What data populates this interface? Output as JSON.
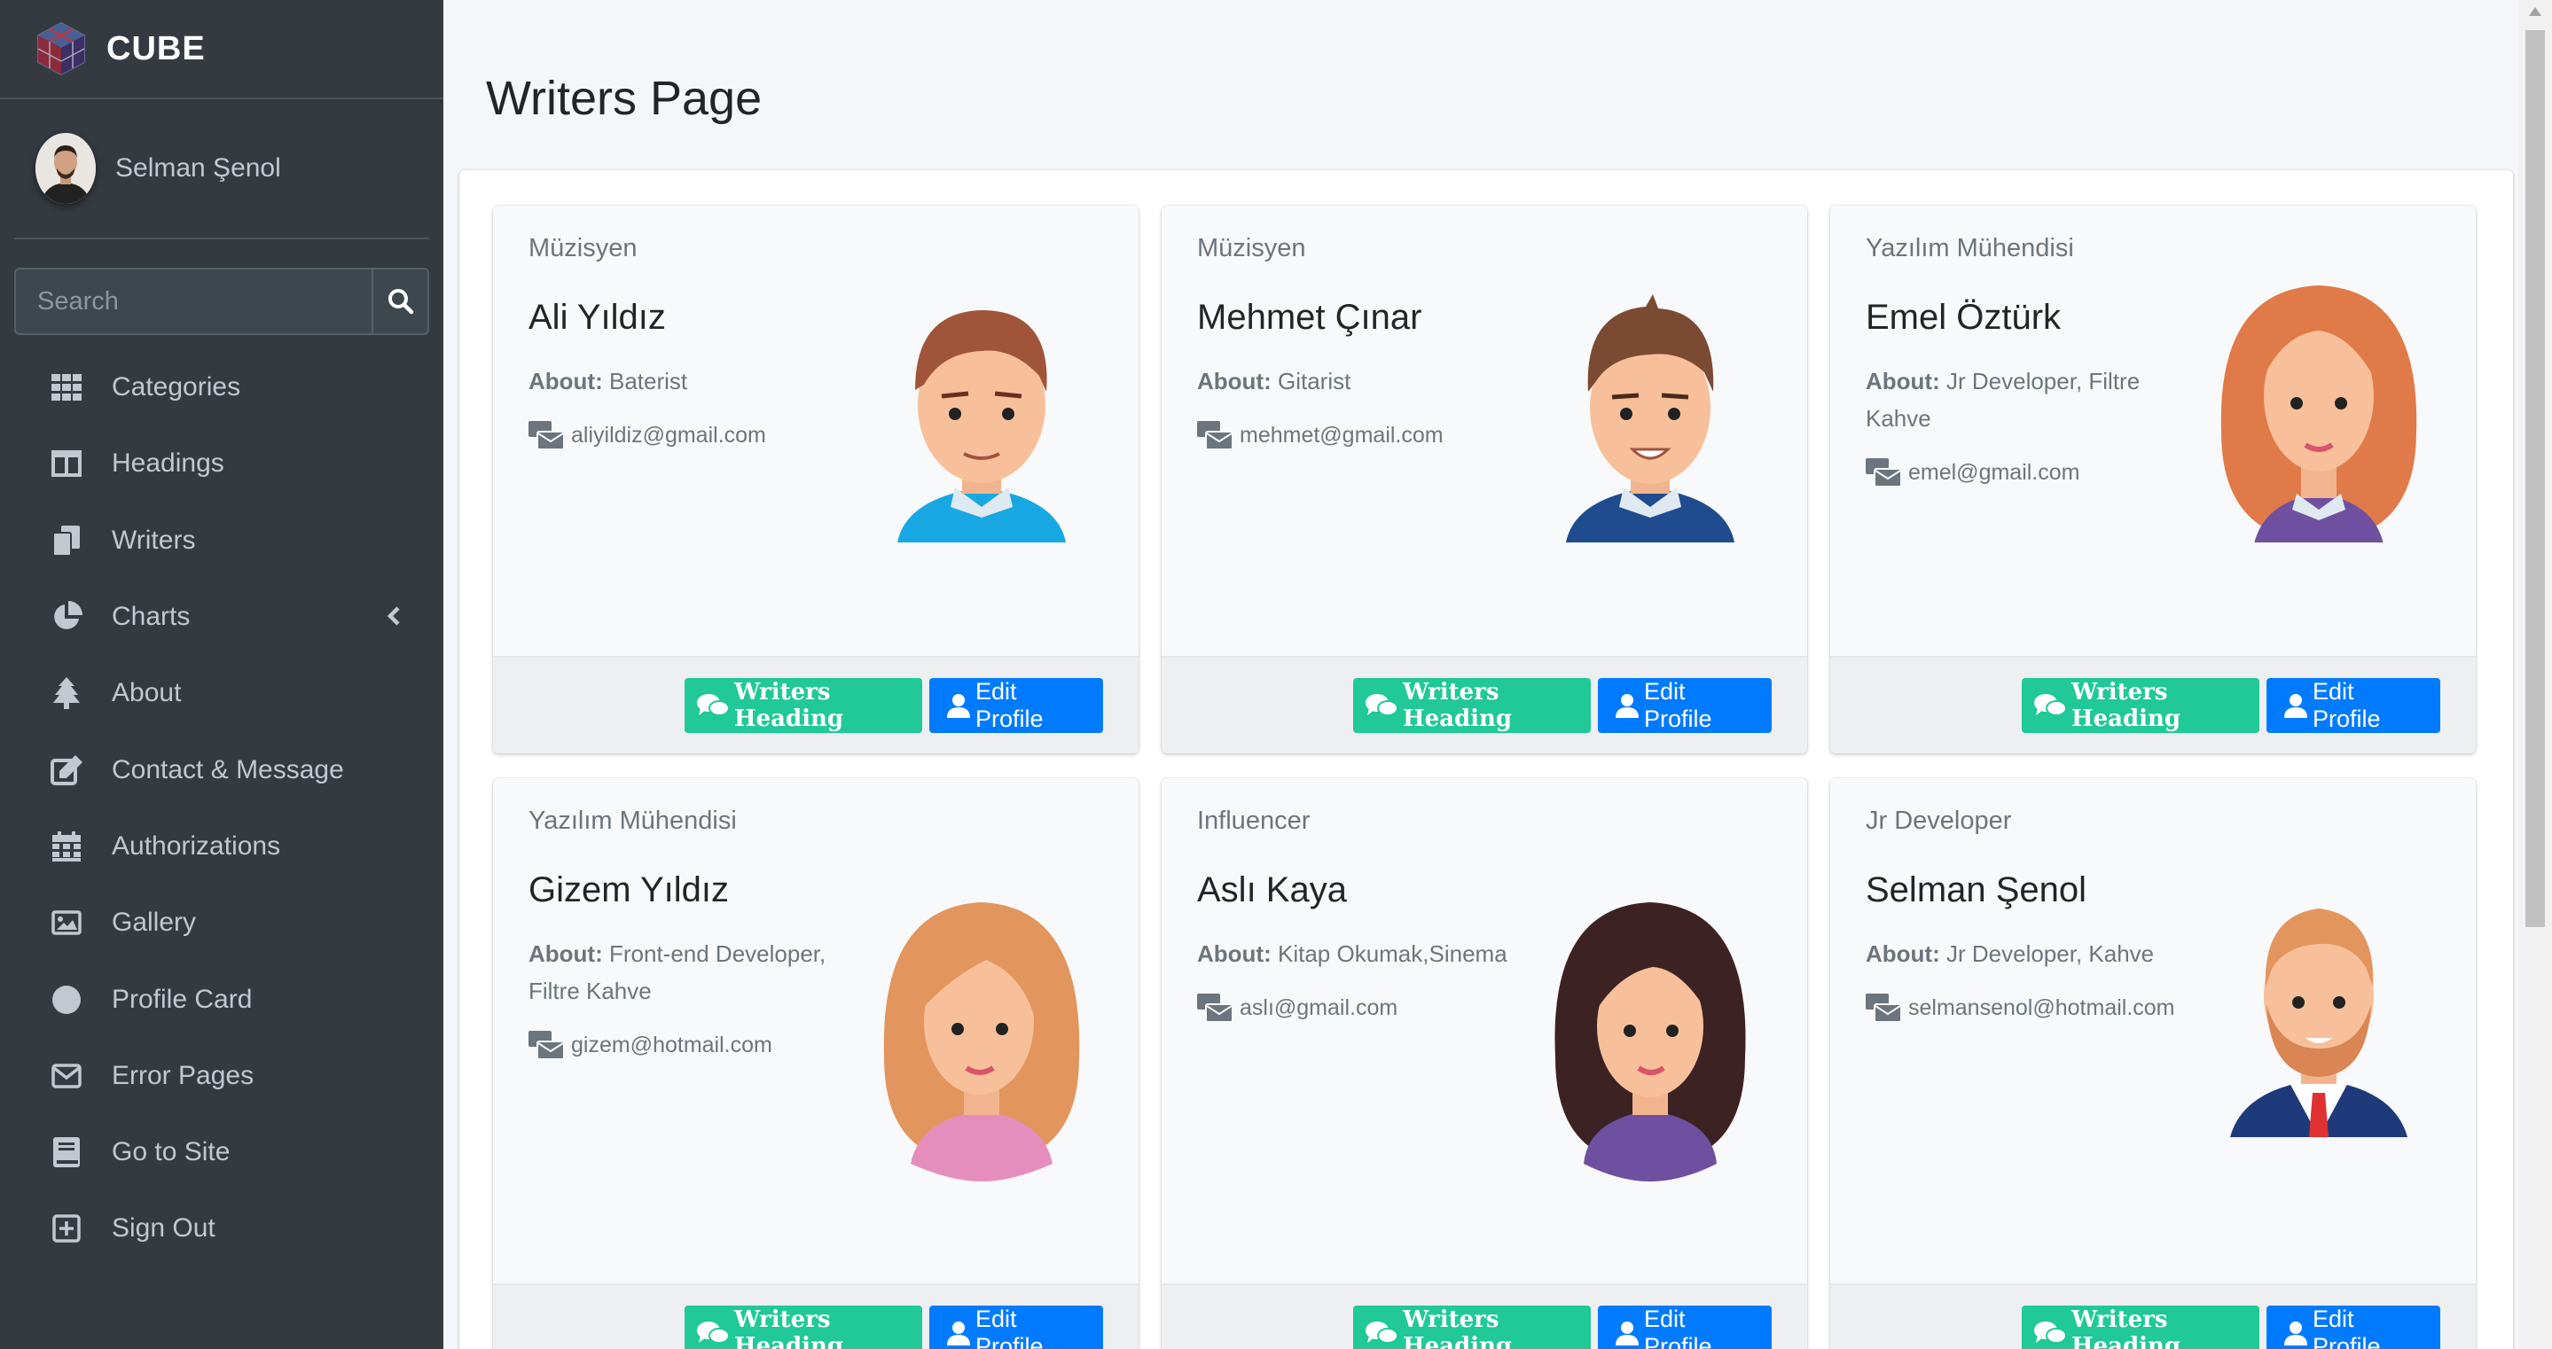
{
  "brand": {
    "name": "CUBE"
  },
  "user": {
    "name": "Selman Şenol"
  },
  "search": {
    "placeholder": "Search"
  },
  "nav": [
    {
      "label": "Categories",
      "icon": "th-icon"
    },
    {
      "label": "Headings",
      "icon": "columns-icon"
    },
    {
      "label": "Writers",
      "icon": "copy-icon"
    },
    {
      "label": "Charts",
      "icon": "chart-pie-icon"
    },
    {
      "label": "About",
      "icon": "tree-icon"
    },
    {
      "label": "Contact & Message",
      "icon": "edit-icon"
    },
    {
      "label": "Authorizations",
      "icon": "calendar-icon"
    },
    {
      "label": "Gallery",
      "icon": "image-icon"
    },
    {
      "label": "Profile Card",
      "icon": "circle-icon"
    },
    {
      "label": "Error Pages",
      "icon": "envelope-icon"
    },
    {
      "label": "Go to Site",
      "icon": "book-icon"
    },
    {
      "label": "Sign Out",
      "icon": "plus-square-icon"
    }
  ],
  "page": {
    "title": "Writers Page"
  },
  "about_label": "About:",
  "buttons": {
    "writers_heading": "Writers Heading",
    "edit_profile": "Edit Profile"
  },
  "writers": [
    {
      "role": "Müzisyen",
      "name": "Ali Yıldız",
      "about": "Baterist",
      "email": "aliyildiz@gmail.com"
    },
    {
      "role": "Müzisyen",
      "name": "Mehmet Çınar",
      "about": "Gitarist",
      "email": "mehmet@gmail.com"
    },
    {
      "role": "Yazılım Mühendisi",
      "name": "Emel Öztürk",
      "about": "Jr Developer, Filtre Kahve",
      "email": "emel@gmail.com"
    },
    {
      "role": "Yazılım Mühendisi",
      "name": "Gizem Yıldız",
      "about": "Front-end Developer, Filtre Kahve",
      "email": "gizem@hotmail.com"
    },
    {
      "role": "Influencer",
      "name": "Aslı Kaya",
      "about": "Kitap Okumak,Sinema",
      "email": "aslı@gmail.com"
    },
    {
      "role": "Jr Developer",
      "name": "Selman Şenol",
      "about": "Jr Developer, Kahve",
      "email": "selmansenol@hotmail.com"
    }
  ],
  "colors": {
    "sidebar": "#343a40",
    "teal": "#20c997",
    "blue": "#007bff"
  }
}
